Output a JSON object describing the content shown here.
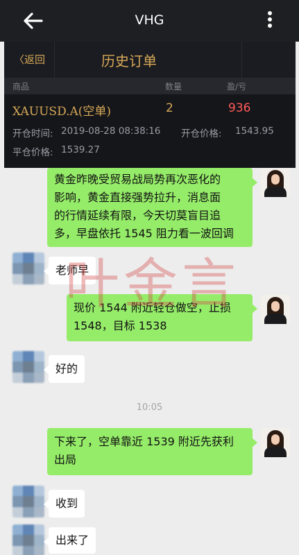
{
  "appbar": {
    "title": "VHG",
    "back_icon": "arrow-left-icon",
    "menu_icon": "more-vertical-icon"
  },
  "order_panel": {
    "back_label": "〈返回",
    "title": "历史订单",
    "columns": {
      "product": "商品",
      "quantity": "数量",
      "pnl": "盈/亏"
    },
    "order": {
      "symbol": "XAUUSD.A(空单)",
      "quantity": "2",
      "pnl": "936",
      "open_time_label": "开仓时间:",
      "open_time": "2019-08-28 08:38:16",
      "open_price_label": "开仓价格:",
      "open_price": "1543.95",
      "close_price_label": "平仓价格:",
      "close_price": "1539.27"
    }
  },
  "watermark": "叶金言",
  "chat": {
    "msg1": [
      "黄金昨晚受贸易战局势再次恶化的",
      "影响，黄金直接强势拉升，消息面",
      "的行情延续有限，今天切莫盲目追",
      "多，早盘依托 1545 阻力看一波回调"
    ],
    "msg2": "老师早",
    "msg3": [
      "现价 1544 附近轻仓做空，止损",
      "1548，目标 1538"
    ],
    "msg4": "好的",
    "time": "10:05",
    "msg5": [
      "下来了，空单靠近 1539 附近先获利",
      "出局"
    ],
    "msg6": "收到",
    "msg7": "出来了"
  },
  "colors": {
    "self_bubble": "#95ec69",
    "accent_gold": "#d6a857",
    "profit_red": "#ff5a5a",
    "watermark": "#d64a4a"
  }
}
